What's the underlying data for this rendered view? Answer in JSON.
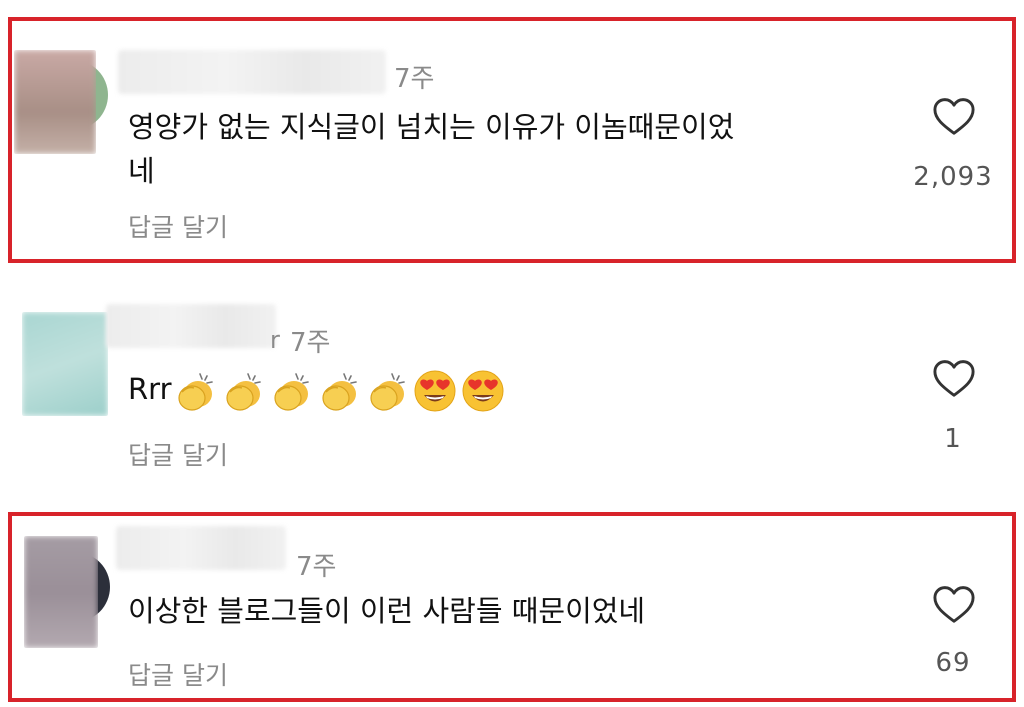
{
  "comments": [
    {
      "name_visible_tail": "",
      "time": "7주",
      "text_line1": "영양가 없는 지식글이 넘치는 이유가 이놈때문이었",
      "text_line2": "네",
      "reply_label": "답글 달기",
      "likes": "2,093",
      "highlighted": true
    },
    {
      "name_visible_tail": "r",
      "time": "7주",
      "text": "Rrr",
      "emojis": [
        "clapping-hands",
        "clapping-hands",
        "clapping-hands",
        "clapping-hands",
        "clapping-hands",
        "heart-eyes",
        "heart-eyes"
      ],
      "reply_label": "답글 달기",
      "likes": "1",
      "highlighted": false
    },
    {
      "name_visible_tail": "",
      "time": "7주",
      "text": "이상한 블로그들이 이런 사람들 때문이었네",
      "reply_label": "답글 달기",
      "likes": "69",
      "highlighted": true
    }
  ],
  "colors": {
    "highlight_border": "#d8232a",
    "muted_text": "#8a8a8a",
    "body_text": "#111111"
  },
  "icons": {
    "like": "heart-outline-icon"
  }
}
